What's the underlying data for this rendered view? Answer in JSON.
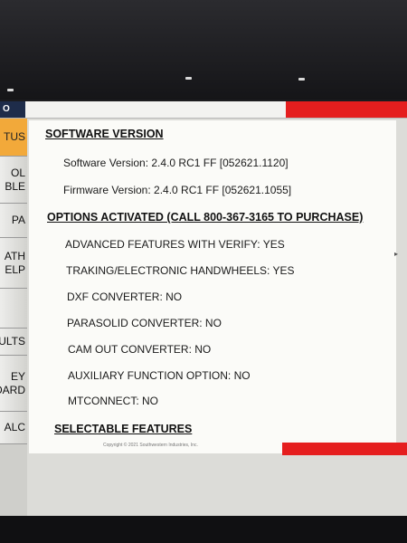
{
  "titlebar": {
    "left_label": "O"
  },
  "sidebar": {
    "tabs": [
      {
        "id": "status",
        "lines": [
          "TUS"
        ]
      },
      {
        "id": "tool-table",
        "lines": [
          "OL",
          "BLE"
        ]
      },
      {
        "id": "pa",
        "lines": [
          "PA"
        ]
      },
      {
        "id": "math-help",
        "lines": [
          "ATH",
          "ELP"
        ]
      },
      {
        "id": "defaults",
        "lines": [
          "AULTS"
        ]
      },
      {
        "id": "keyboard",
        "lines": [
          "EY",
          "OARD"
        ]
      },
      {
        "id": "calc",
        "lines": [
          "ALC"
        ]
      }
    ]
  },
  "content": {
    "software_heading": "SOFTWARE VERSION",
    "software_version": "Software Version: 2.4.0 RC1 FF [052621.1120]",
    "firmware_version": "Firmware Version: 2.4.0 RC1 FF [052621.1055]",
    "options_heading": "OPTIONS ACTIVATED (CALL 800-367-3165 TO PURCHASE)",
    "options": [
      "ADVANCED FEATURES WITH VERIFY: YES",
      "TRAKING/ELECTRONIC HANDWHEELS: YES",
      "DXF CONVERTER: NO",
      "PARASOLID CONVERTER: NO",
      "CAM OUT CONVERTER: NO",
      "AUXILIARY FUNCTION OPTION: NO",
      "MTCONNECT: NO"
    ],
    "selectable_heading": "SELECTABLE FEATURES",
    "copyright": "Copyright © 2021 Southwestern Industries, Inc."
  },
  "colors": {
    "accent_red": "#e51e1e",
    "active_tab": "#f2a93a",
    "titlebar_dark": "#1e2c4a"
  },
  "icons": {
    "scroll": "scroll-arrow-icon"
  }
}
